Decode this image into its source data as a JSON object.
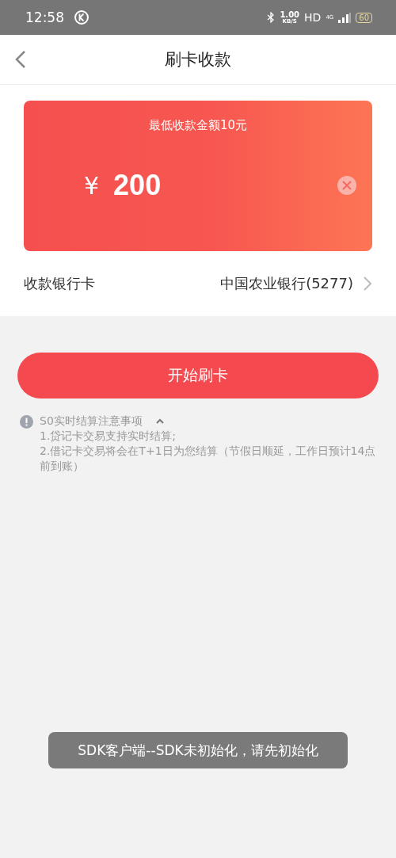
{
  "status_bar": {
    "time": "12:58",
    "speed": "1.00",
    "speed_unit": "KB/S",
    "hd": "HD",
    "network": "4G",
    "battery": "60"
  },
  "nav": {
    "title": "刷卡收款"
  },
  "amount_card": {
    "hint": "最低收款金额10元",
    "currency": "¥",
    "value": "200"
  },
  "bank_row": {
    "label": "收款银行卡",
    "value": "中国农业银行(5277)"
  },
  "primary_button": {
    "label": "开始刷卡"
  },
  "notes": {
    "title": "S0实时结算注意事项",
    "expanded": true,
    "items": [
      "1.贷记卡交易支持实时结算;",
      "2.借记卡交易将会在T+1日为您结算（节假日顺延，工作日预计14点前到账）"
    ]
  },
  "toast": {
    "text": "SDK客户端--SDK未初始化，请先初始化"
  }
}
